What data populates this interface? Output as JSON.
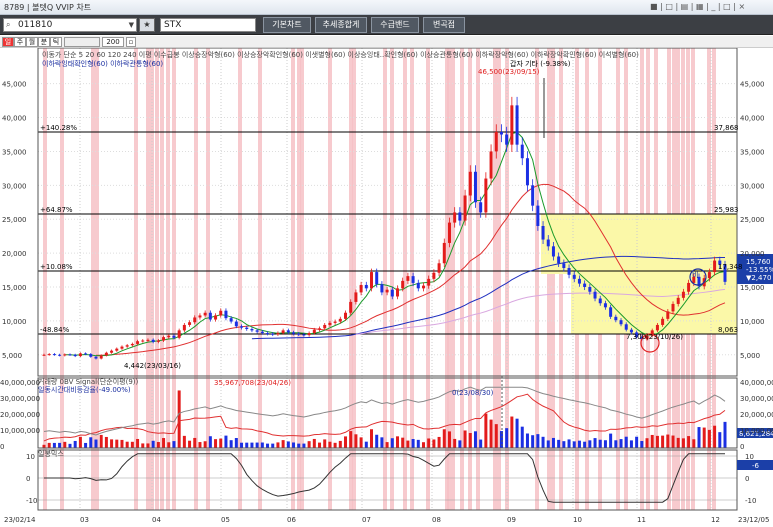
{
  "window": {
    "title": "8789 | 볼텟Q VVIP 차트",
    "ctrl": "■ | □ | ▤ | ▦ | _ | □ | ×"
  },
  "toolbar": {
    "code": "011810",
    "name": "STX",
    "tabs": [
      "기본차트",
      "추세종합게",
      "수급밴드",
      "변곡점"
    ]
  },
  "period": {
    "buttons": [
      "일",
      "주",
      "월",
      "분",
      "틱"
    ],
    "count": "200"
  },
  "legend": {
    "row1": "이동가 단순 5 20 60 120 240 이평 이수급봉 이상승장악형(60) 이상승장악확인형(60) 이샛별형(60) 이상승잉태..확인형(60) 이상승관통형(60) 이하락장악형(60) 이하락장악확인형(60) 이석별형(60)",
    "row2": "이하락잉태확인형(60) 이하락관통형(60)"
  },
  "annotations": {
    "high": "46,500(23/09/15)",
    "note": "갑자 기타 (-9.38%)",
    "low_start": "4,442(23/03/16)",
    "low_end": "7,300(23/10/26)",
    "lvl1_pct": "+140.28%",
    "lvl1_val": "37,868",
    "lvl2_pct": "+64.87%",
    "lvl2_val": "25,983",
    "lvl3_pct": "+10.08%",
    "lvl3_val": "17,348",
    "lvl4_pct": "-48.84%",
    "lvl4_val": "8,063",
    "price": "15,760",
    "chg_pct": "-13.55%",
    "chg": "▼2,470",
    "bi": "비"
  },
  "price_axis": [
    "45,000",
    "40,000",
    "35,000",
    "30,000",
    "25,000",
    "20,000",
    "15,000",
    "10,000",
    "5,000"
  ],
  "volume": {
    "legend1": "거래량 0BV Signal(단순이평(9))",
    "legend2": "일동시간대비등감율(-49.00%)",
    "peak": "35,967,708(23/04/26)",
    "mark": "0(23/08/30)",
    "left_axis": [
      "40,000,000",
      "30,000,000",
      "20,000,000",
      "10,000,000",
      "0"
    ],
    "right_axis": [
      "40,000,000",
      "30,000,000",
      "20,000,000",
      "10,000,000",
      "0"
    ],
    "current": "8,621,284"
  },
  "osc": {
    "title": "일봉믹스",
    "axis": [
      "10",
      "0",
      "-10"
    ],
    "current": "-6"
  },
  "dates": [
    "23/02/14",
    "03",
    "04",
    "05",
    "06",
    "07",
    "08",
    "09",
    "10",
    "11",
    "12",
    "23/12/05"
  ],
  "colors": {
    "up": "#e31b1b",
    "down": "#1b2fe3",
    "ma5": "#1a9a2a",
    "ma20": "#e03030",
    "ma60": "#2030c0",
    "ma120": "#d090d0",
    "band": "#fbf8a8",
    "stripe": "#f6c1c6"
  }
}
